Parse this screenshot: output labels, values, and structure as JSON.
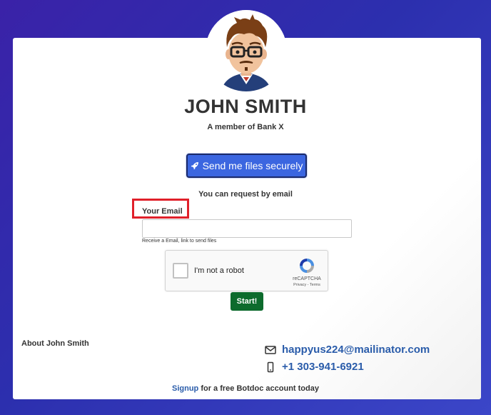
{
  "profile": {
    "name": "JOHN SMITH",
    "subtitle": "A member of Bank X"
  },
  "actions": {
    "send_label": "Send me files securely",
    "request_note": "You can request by email",
    "start_label": "Start!"
  },
  "email_form": {
    "label": "Your Email",
    "value": "",
    "help": "Receive a Email, link to send files"
  },
  "captcha": {
    "checkbox_label": "I'm not a robot",
    "brand": "reCAPTCHA",
    "links": "Privacy - Terms"
  },
  "about": {
    "heading": "About John Smith"
  },
  "contact": {
    "email": "happyus224@mailinator.com",
    "phone": "+1 303-941-6921"
  },
  "footer": {
    "signup_link": "Signup",
    "rest": " for a free Botdoc account today"
  },
  "icons": {
    "send": "rocket-icon",
    "email": "envelope-icon",
    "phone": "mobile-phone-icon",
    "captcha": "recaptcha-logo-icon"
  },
  "colors": {
    "primary_button": "#3b66e0",
    "start_button": "#0d6b2d",
    "link": "#2a5caa",
    "highlight_box": "#e0202a"
  }
}
